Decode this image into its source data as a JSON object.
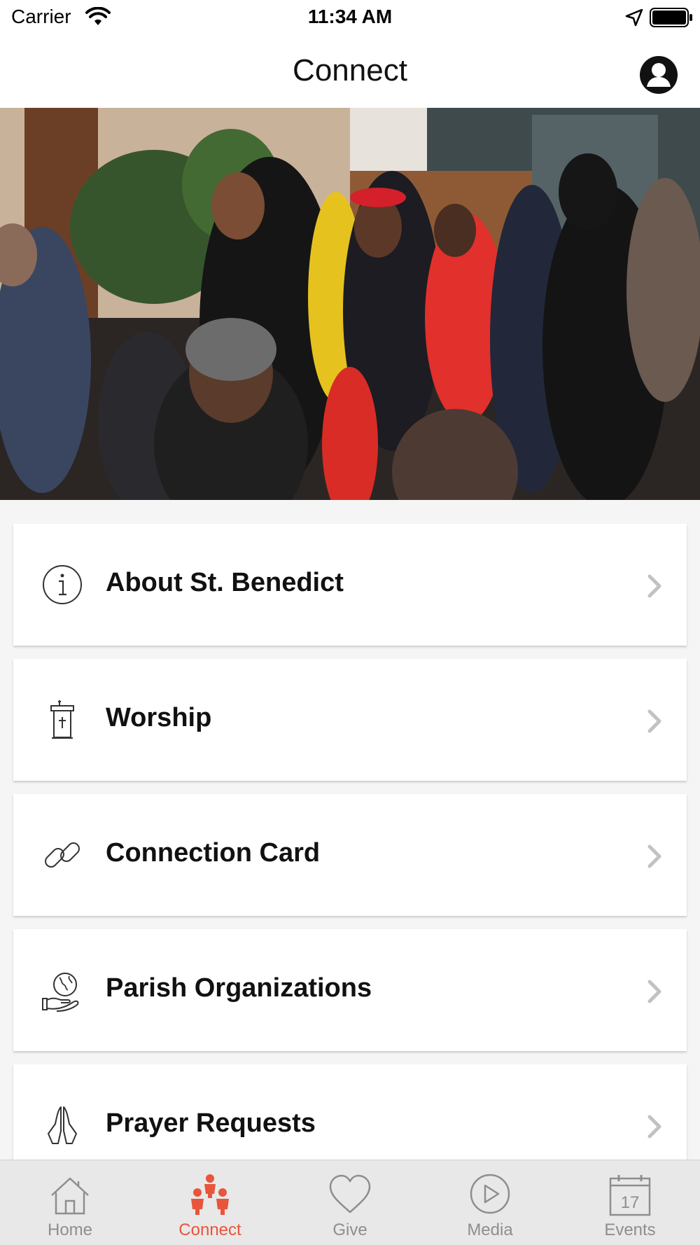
{
  "status_bar": {
    "carrier": "Carrier",
    "time": "11:34 AM"
  },
  "nav": {
    "title": "Connect"
  },
  "menu": {
    "items": [
      {
        "label": "About St. Benedict",
        "icon": "info-icon"
      },
      {
        "label": "Worship",
        "icon": "pulpit-icon"
      },
      {
        "label": "Connection Card",
        "icon": "link-icon"
      },
      {
        "label": "Parish Organizations",
        "icon": "globe-hand-icon"
      },
      {
        "label": "Prayer Requests",
        "icon": "praying-hands-icon"
      }
    ]
  },
  "tabs": {
    "items": [
      {
        "label": "Home",
        "icon": "home-icon",
        "active": false
      },
      {
        "label": "Connect",
        "icon": "people-icon",
        "active": true
      },
      {
        "label": "Give",
        "icon": "heart-icon",
        "active": false
      },
      {
        "label": "Media",
        "icon": "play-icon",
        "active": false
      },
      {
        "label": "Events",
        "icon": "calendar-icon",
        "active": false
      }
    ],
    "calendar_day": "17"
  },
  "colors": {
    "accent": "#e8553a",
    "inactive": "#8e8e8e",
    "background": "#f5f5f5"
  }
}
